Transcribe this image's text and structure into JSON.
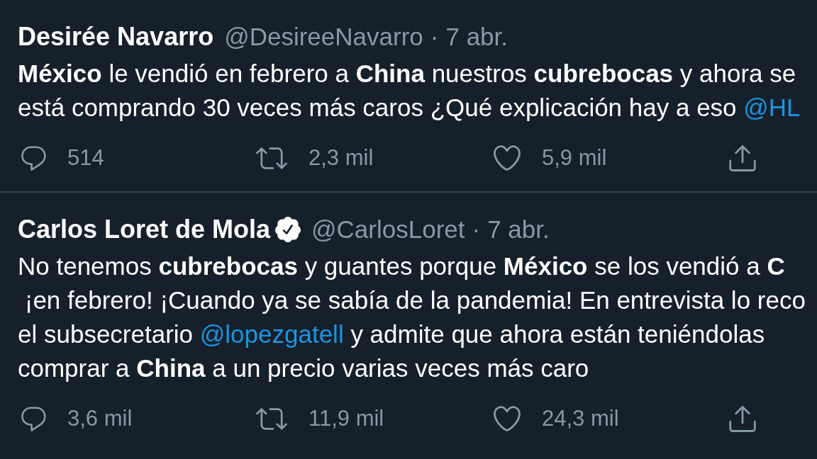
{
  "tweets": [
    {
      "author": {
        "name": "Desirée Navarro",
        "verified": false,
        "handle": "@DesireeNavarro",
        "separator": "·",
        "time": "7 abr."
      },
      "text_lines": [
        [
          {
            "kind": "text",
            "text": "**México** le vendió en febrero a **China** nuestros **cubrebocas** y ahora se"
          }
        ],
        [
          {
            "kind": "text",
            "text": "está comprando 30 veces más caros ¿Qué explicación hay a eso "
          },
          {
            "kind": "mention",
            "text": "@HL"
          }
        ]
      ],
      "actions": [
        {
          "kind": "reply",
          "count": "514"
        },
        {
          "kind": "retweet",
          "count": "2,3 mil"
        },
        {
          "kind": "like",
          "count": "5,9 mil"
        },
        {
          "kind": "share"
        }
      ]
    },
    {
      "author": {
        "name": "Carlos Loret de Mola",
        "verified": true,
        "handle": "@CarlosLoret",
        "separator": "·",
        "time": "7 abr."
      },
      "text_lines": [
        [
          {
            "kind": "text",
            "text": "No tenemos **cubrebocas** y guantes porque **México** se los vendió a **C**"
          }
        ],
        [
          {
            "kind": "text",
            "text": " ¡en febrero! ¡Cuando ya se sabía de la pandemia! En entrevista lo reco"
          }
        ],
        [
          {
            "kind": "text",
            "text": "el subsecretario "
          },
          {
            "kind": "mention",
            "text": "@lopezgatell"
          },
          {
            "kind": "text",
            "text": " y admite que ahora están teniéndolas"
          }
        ],
        [
          {
            "kind": "text",
            "text": "comprar a **China** a un precio varias veces más caro"
          }
        ]
      ],
      "actions": [
        {
          "kind": "reply",
          "count": "3,6 mil"
        },
        {
          "kind": "retweet",
          "count": "11,9 mil"
        },
        {
          "kind": "like",
          "count": "24,3 mil"
        },
        {
          "kind": "share"
        }
      ]
    }
  ]
}
